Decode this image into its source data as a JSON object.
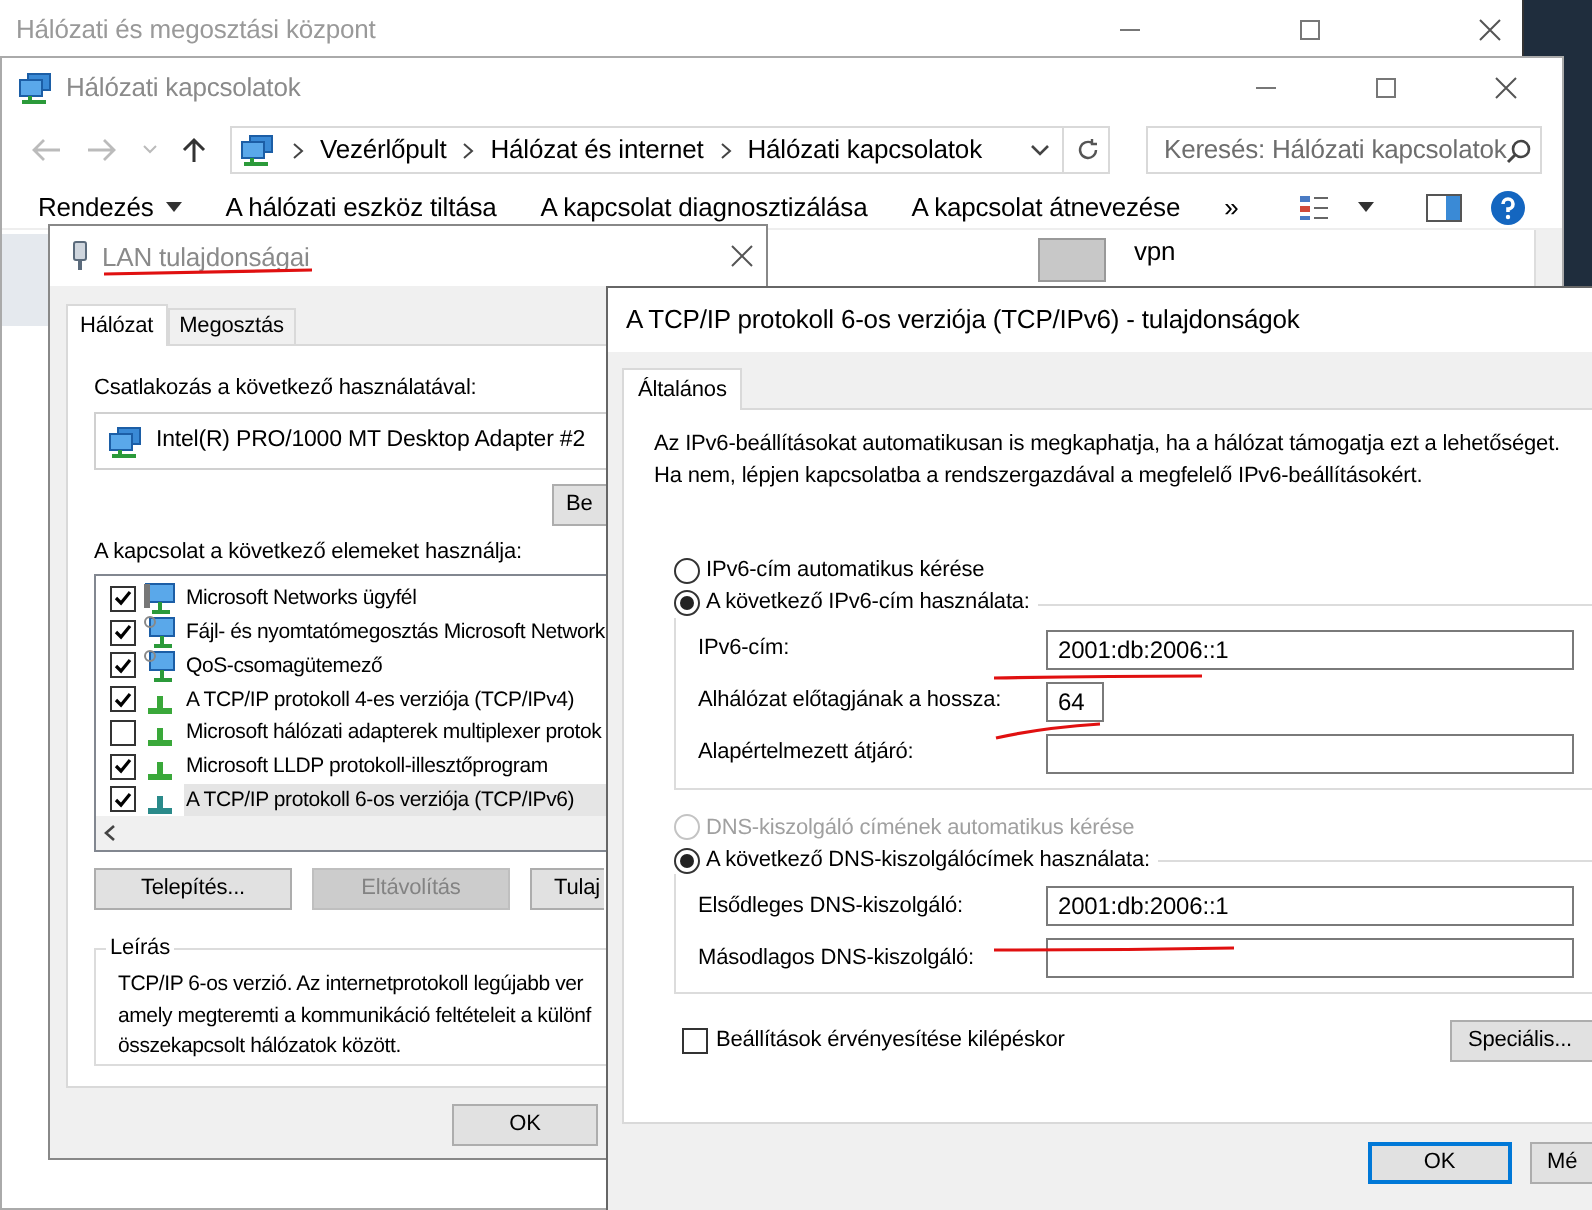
{
  "background_window": {
    "title": "Hálózati és megosztási központ"
  },
  "explorer": {
    "title": "Hálózati kapcsolatok",
    "breadcrumb": [
      "Vezérlőpult",
      "Hálózat és internet",
      "Hálózati kapcsolatok"
    ],
    "search": {
      "placeholder": "Keresés: Hálózati kapcsolatok"
    },
    "toolbar": [
      {
        "label": "Rendezés",
        "kind": "menu"
      },
      {
        "label": "A hálózati eszköz tiltása",
        "kind": "command"
      },
      {
        "label": "A kapcsolat diagnosztizálása",
        "kind": "command"
      },
      {
        "label": "A kapcsolat átnevezése",
        "kind": "command"
      },
      {
        "label": "»",
        "kind": "command"
      }
    ],
    "items": [
      {
        "label": "vpn"
      }
    ]
  },
  "lan_dialog": {
    "title": "LAN tulajdonságai",
    "tabs": [
      {
        "label": "Hálózat",
        "selected": true
      },
      {
        "label": "Megosztás",
        "selected": false
      }
    ],
    "connect_label": "Csatlakozás a következő használatával:",
    "adapter": "Intel(R) PRO/1000 MT Desktop Adapter #2",
    "configure_button": "Be",
    "components_label": "A kapcsolat a következő elemeket használja:",
    "components": [
      {
        "label": "Microsoft Networks ügyfél",
        "kind": "client",
        "checked": true,
        "selected": false
      },
      {
        "label": "Fájl- és nyomtatómegosztás Microsoft Network",
        "kind": "service",
        "checked": true,
        "selected": false
      },
      {
        "label": "QoS-csomagütemező",
        "kind": "service",
        "checked": true,
        "selected": false
      },
      {
        "label": "A TCP/IP protokoll 4-es verziója (TCP/IPv4)",
        "kind": "protocol",
        "checked": true,
        "selected": false
      },
      {
        "label": "Microsoft hálózati adapterek multiplexer protok",
        "kind": "protocol",
        "checked": false,
        "selected": false
      },
      {
        "label": "Microsoft LLDP protokoll-illesztőprogram",
        "kind": "protocol",
        "checked": true,
        "selected": false
      },
      {
        "label": "A TCP/IP protokoll 6-os verziója (TCP/IPv6)",
        "kind": "protocol",
        "checked": true,
        "selected": true
      }
    ],
    "buttons": [
      {
        "label": "Telepítés...",
        "disabled": false
      },
      {
        "label": "Eltávolítás",
        "disabled": true
      },
      {
        "label": "Tulaj",
        "disabled": false
      }
    ],
    "description": {
      "title": "Leírás",
      "lines": [
        "TCP/IP 6-os verzió. Az internetprotokoll legújabb ver",
        "amely megteremti a kommunikáció feltételeit a különf",
        "összekapcsolt hálózatok között."
      ]
    },
    "ok_button": "OK"
  },
  "ipv6_dialog": {
    "title": "A TCP/IP protokoll 6-os verziója (TCP/IPv6) - tulajdonságok",
    "tabs": [
      {
        "label": "Általános",
        "selected": true
      }
    ],
    "intro": [
      "Az IPv6-beállításokat automatikusan is megkaphatja, ha a hálózat támogatja ezt a lehetőséget.",
      "Ha nem, lépjen kapcsolatba a rendszergazdával a megfelelő IPv6-beállításokért."
    ],
    "address_mode": [
      {
        "label": "IPv6-cím automatikus kérése",
        "selected": false,
        "disabled": false
      },
      {
        "label": "A következő IPv6-cím használata:",
        "selected": true,
        "disabled": false
      }
    ],
    "address_fields": [
      {
        "label": "IPv6-cím:",
        "value": "2001:db:2006::1",
        "kind": "wide"
      },
      {
        "label": "Alhálózat előtagjának a hossza:",
        "value": "64",
        "kind": "narrow"
      },
      {
        "label": "Alapértelmezett átjáró:",
        "kind": "wide"
      }
    ],
    "dns_mode": [
      {
        "label": "DNS-kiszolgáló címének automatikus kérése",
        "selected": false,
        "disabled": true
      },
      {
        "label": "A következő DNS-kiszolgálócímek használata:",
        "selected": true,
        "disabled": false
      }
    ],
    "dns_fields": [
      {
        "label": "Elsődleges DNS-kiszolgáló:",
        "value": "2001:db:2006::1",
        "kind": "wide"
      },
      {
        "label": "Másodlagos DNS-kiszolgáló:",
        "kind": "wide"
      }
    ],
    "validate_on_exit": {
      "label": "Beállítások érvényesítése kilépéskor",
      "checked": false
    },
    "advanced_button": "Speciális...",
    "buttons": [
      {
        "label": "OK",
        "focused": true
      },
      {
        "label": "Mé",
        "focused": false
      }
    ]
  }
}
